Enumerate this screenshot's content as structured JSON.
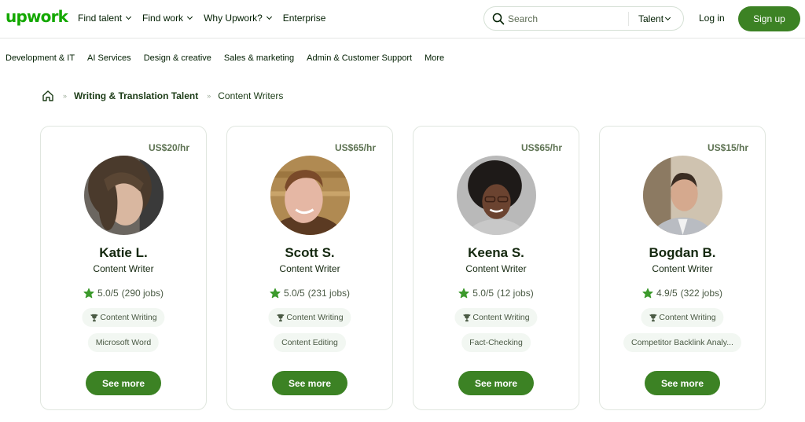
{
  "header": {
    "logo": "upwork",
    "nav": [
      {
        "label": "Find talent",
        "dropdown": true
      },
      {
        "label": "Find work",
        "dropdown": true
      },
      {
        "label": "Why Upwork?",
        "dropdown": true
      },
      {
        "label": "Enterprise",
        "dropdown": false
      }
    ],
    "search": {
      "placeholder": "Search",
      "value": "",
      "scope": "Talent"
    },
    "login_label": "Log in",
    "signup_label": "Sign up"
  },
  "categories": [
    "Development & IT",
    "AI Services",
    "Design & creative",
    "Sales & marketing",
    "Admin & Customer Support",
    "More"
  ],
  "breadcrumb": {
    "separator": "»",
    "items": [
      "Writing & Translation Talent",
      "Content Writers"
    ]
  },
  "colors": {
    "brand": "#14a800",
    "button": "#3c8224",
    "star": "#3c9a2c",
    "pill_bg": "#f2f7f2",
    "rate": "#5e7353"
  },
  "cards": [
    {
      "rate": "US$20/hr",
      "name": "Katie L.",
      "title": "Content Writer",
      "rating": "5.0/5",
      "jobs": "(290 jobs)",
      "skills": [
        "Content Writing",
        "Microsoft Word"
      ],
      "cta": "See more",
      "avatar_desc": "woman with brown hair"
    },
    {
      "rate": "US$65/hr",
      "name": "Scott S.",
      "title": "Content Writer",
      "rating": "5.0/5",
      "jobs": "(231 jobs)",
      "skills": [
        "Content Writing",
        "Content Editing"
      ],
      "cta": "See more",
      "avatar_desc": "smiling man with short red hair"
    },
    {
      "rate": "US$65/hr",
      "name": "Keena S.",
      "title": "Content Writer",
      "rating": "5.0/5",
      "jobs": "(12 jobs)",
      "skills": [
        "Content Writing",
        "Fact-Checking"
      ],
      "cta": "See more",
      "avatar_desc": "woman with curly hair and glasses"
    },
    {
      "rate": "US$15/hr",
      "name": "Bogdan B.",
      "title": "Content Writer",
      "rating": "4.9/5",
      "jobs": "(322 jobs)",
      "skills": [
        "Content Writing",
        "Competitor Backlink Analy..."
      ],
      "cta": "See more",
      "avatar_desc": "man in grey blazer"
    }
  ]
}
